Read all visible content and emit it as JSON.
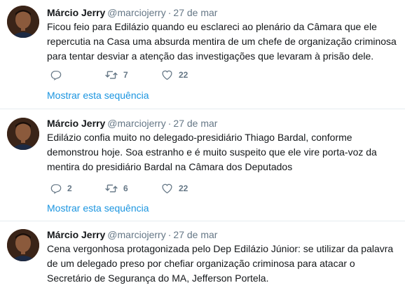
{
  "tweets": [
    {
      "name": "Márcio Jerry",
      "handle": "@marciojerry",
      "dot": "·",
      "date": "27 de mar",
      "text": "Ficou feio para Edilázio quando eu esclareci ao plenário da Câmara que ele repercutia na Casa uma absurda mentira de um chefe de organização criminosa para tentar desviar a atenção das investigações que levaram à prisão dele.",
      "replies": "",
      "retweets": "7",
      "likes": "22",
      "thread_link": "Mostrar esta sequência"
    },
    {
      "name": "Márcio Jerry",
      "handle": "@marciojerry",
      "dot": "·",
      "date": "27 de mar",
      "text": "Edilázio confia muito no delegado-presidiário Thiago Bardal, conforme demonstrou hoje. Soa estranho e é muito suspeito que ele vire porta-voz da mentira do presidiário Bardal na Câmara dos Deputados",
      "replies": "2",
      "retweets": "6",
      "likes": "22",
      "thread_link": "Mostrar esta sequência"
    },
    {
      "name": "Márcio Jerry",
      "handle": "@marciojerry",
      "dot": "·",
      "date": "27 de mar",
      "text": "Cena vergonhosa protagonizada pelo Dep Edilázio Júnior: se utilizar da palavra de um delegado preso por chefiar organização criminosa para atacar o Secretário de Segurança do MA, Jefferson Portela."
    }
  ],
  "icons": {
    "reply": "reply-icon",
    "retweet": "retweet-icon",
    "like": "heart-icon"
  },
  "colors": {
    "link": "#1b95e0",
    "secondary_text": "#657786",
    "divider": "#e6ecf0"
  }
}
